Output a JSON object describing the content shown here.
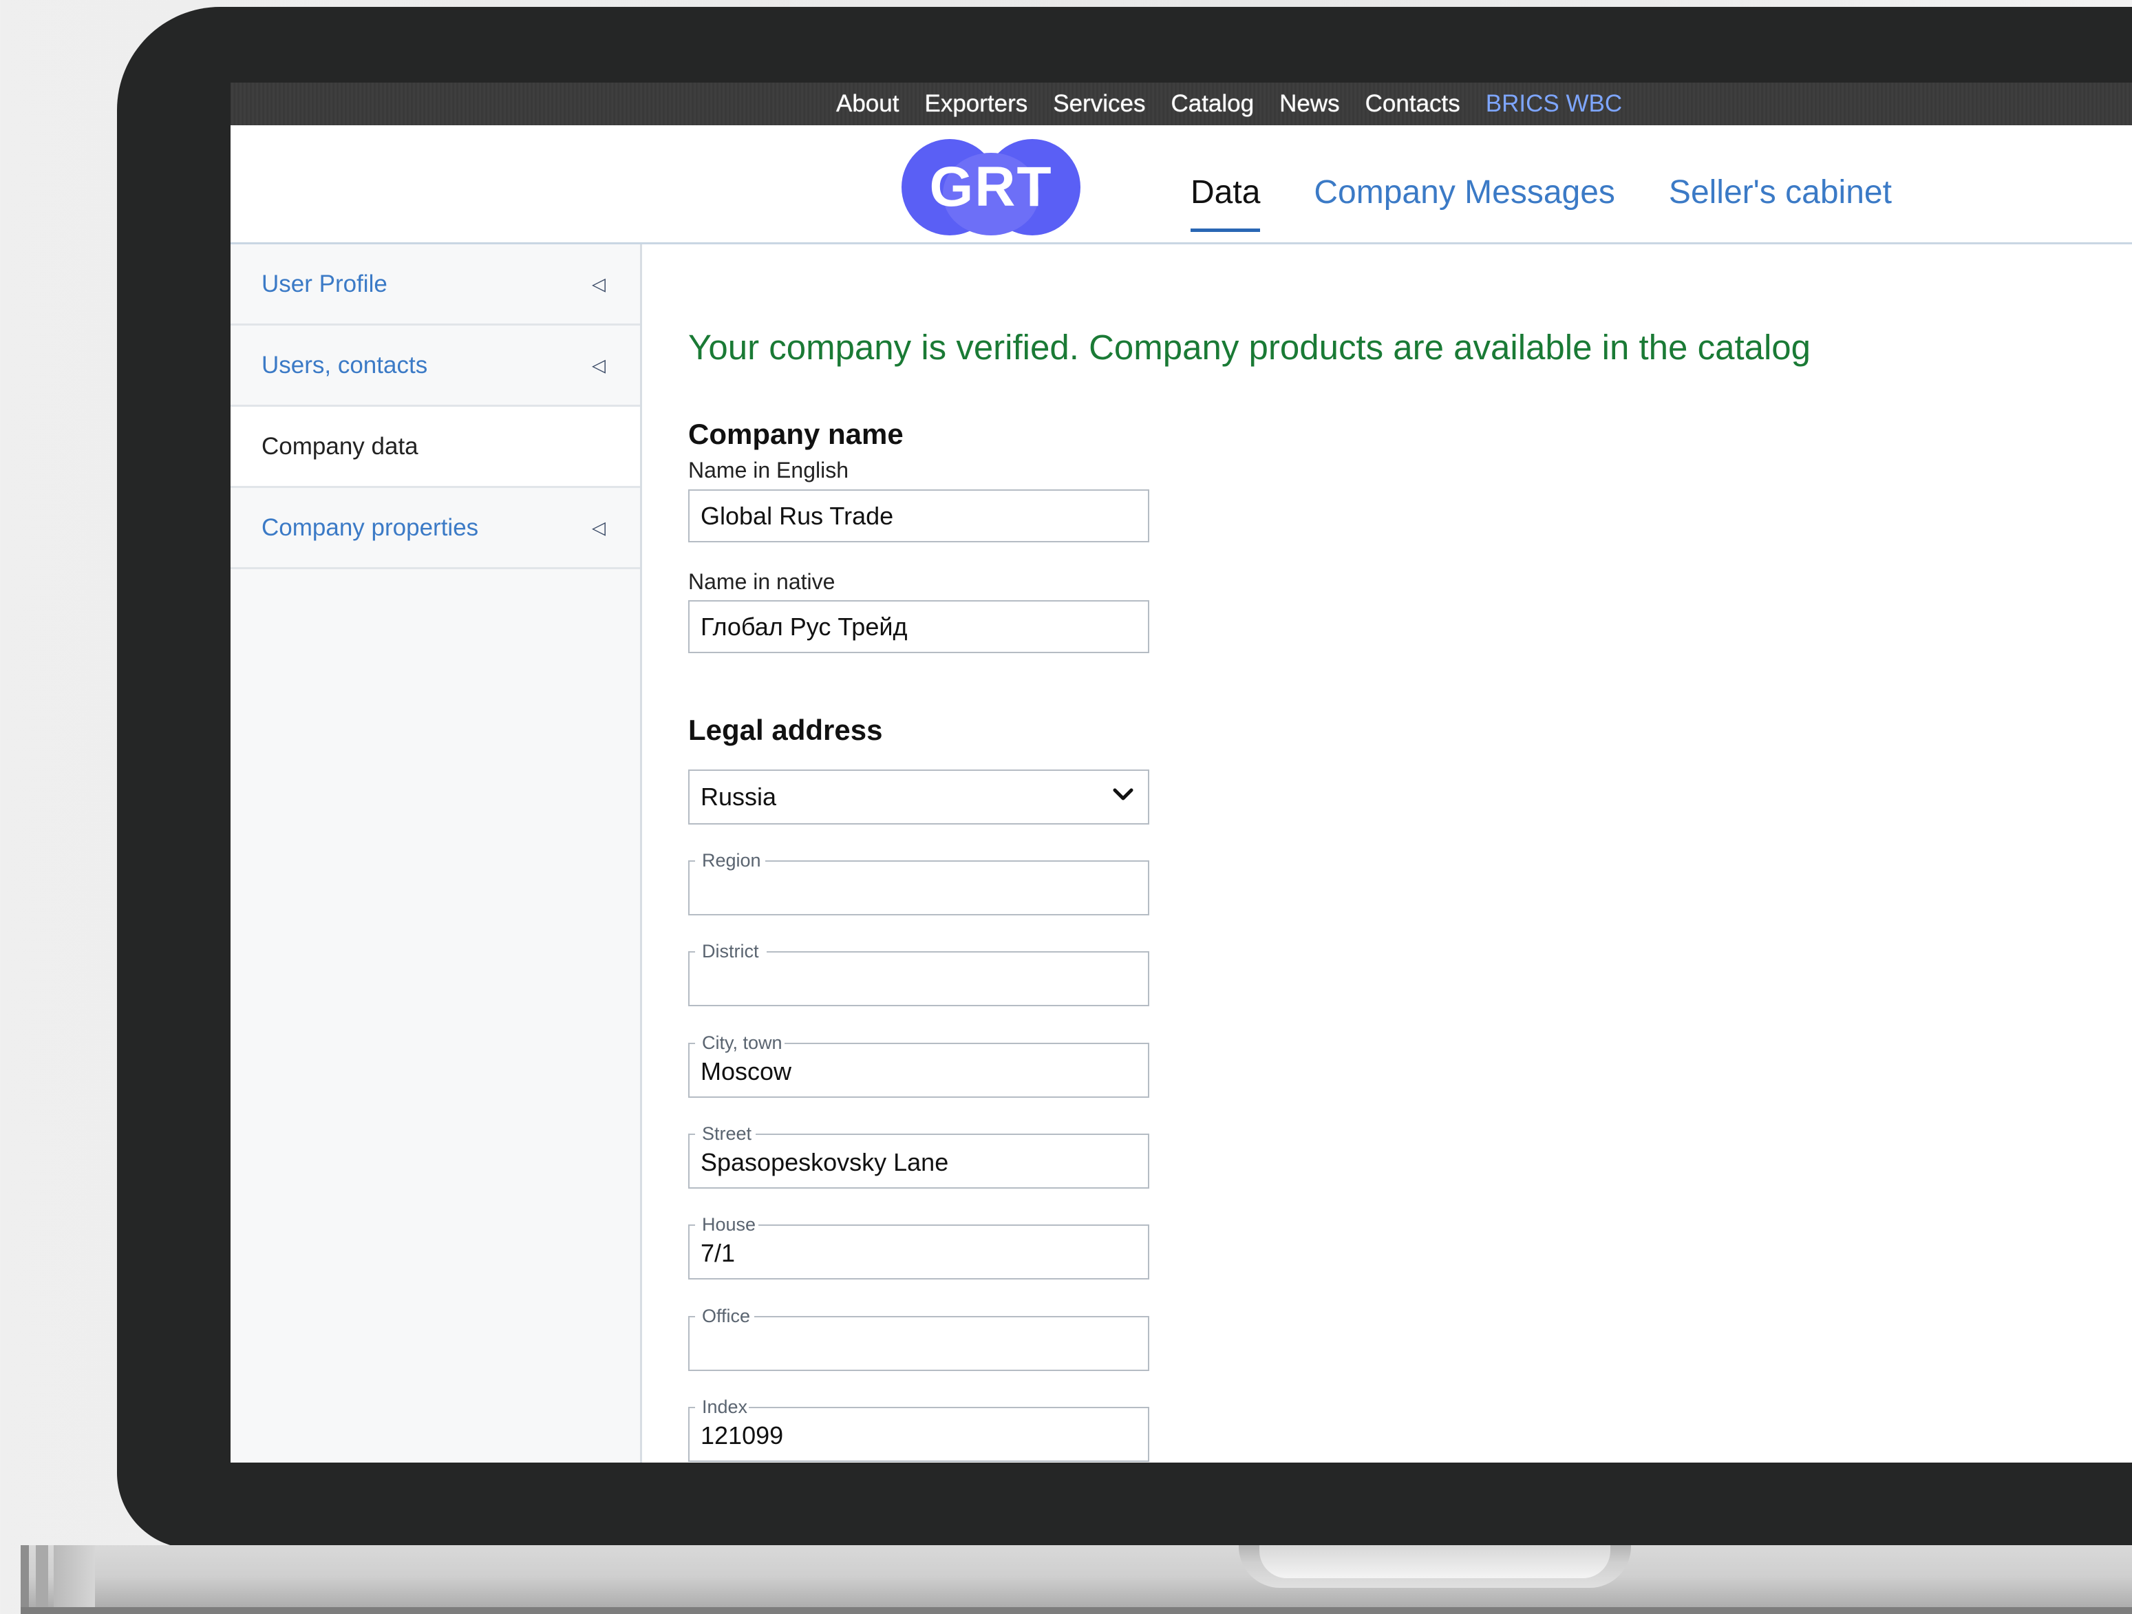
{
  "topnav": {
    "items": [
      "About",
      "Exporters",
      "Services",
      "Catalog",
      "News",
      "Contacts",
      "BRICS WBC"
    ]
  },
  "logo": {
    "text": "GRT"
  },
  "tabs": [
    "Data",
    "Company Messages",
    "Seller's cabinet"
  ],
  "sidebar": {
    "items": [
      "User Profile",
      "Users, contacts",
      "Company data",
      "Company properties"
    ]
  },
  "main": {
    "verified_message": "Your company is verified. Company products are available in the catalog",
    "company_name": {
      "title": "Company name",
      "english_label": "Name in English",
      "english_value": "Global Rus Trade",
      "native_label": "Name in native",
      "native_value": "Глобал Рус Трейд"
    },
    "legal_address": {
      "title": "Legal address",
      "country": "Russia",
      "region_label": "Region",
      "region_value": "",
      "district_label": "District",
      "district_value": "",
      "city_label": "City, town",
      "city_value": "Moscow",
      "street_label": "Street",
      "street_value": "Spasopeskovsky Lane",
      "house_label": "House",
      "house_value": "7/1",
      "office_label": "Office",
      "office_value": "",
      "index_label": "Index",
      "index_value": "121099"
    }
  },
  "colors": {
    "accent_blue": "#3b7ac6",
    "verified_green": "#1a7a35",
    "logo_purple": "#5a5ff5",
    "nav_highlight": "#7ea6ff"
  }
}
